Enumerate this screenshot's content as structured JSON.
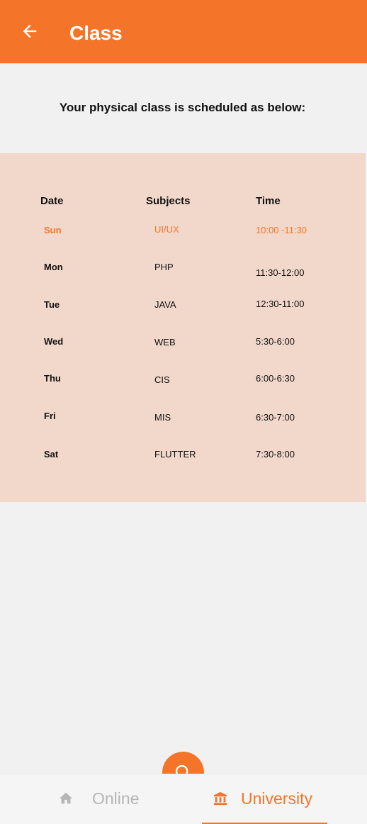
{
  "app_bar": {
    "title": "Class",
    "back_icon": "arrow-left-icon",
    "background": "#f47529"
  },
  "intro_text": "Your physical class is scheduled as below:",
  "schedule": {
    "headers": {
      "date": "Date",
      "subjects": "Subjects",
      "time": "Time"
    },
    "rows": [
      {
        "day": "Sun",
        "subject": "UI/UX",
        "time": "10:00 -11:30",
        "active": true
      },
      {
        "day": "Mon",
        "subject": "PHP",
        "time": "11:30-12:00",
        "active": false
      },
      {
        "day": "Tue",
        "subject": "JAVA",
        "time": "12:30-11:00",
        "active": false
      },
      {
        "day": "Wed",
        "subject": "WEB",
        "time": "5:30-6:00",
        "active": false
      },
      {
        "day": "Thu",
        "subject": "CIS",
        "time": "6:00-6:30",
        "active": false
      },
      {
        "day": "Fri",
        "subject": "MIS",
        "time": "6:30-7:00",
        "active": false
      },
      {
        "day": "Sat",
        "subject": "FLUTTER",
        "time": "7:30-8:00",
        "active": false
      }
    ],
    "background": "#f2d8ca"
  },
  "bottom_nav": {
    "tabs": [
      {
        "label": "Online",
        "icon": "home-icon",
        "selected": false
      },
      {
        "label": "University",
        "icon": "university-icon",
        "selected": true
      }
    ],
    "fab_icon": "search-icon"
  },
  "colors": {
    "accent": "#f47529",
    "page_background": "#f1f1f1",
    "inactive_text": "#b5b5b5"
  }
}
